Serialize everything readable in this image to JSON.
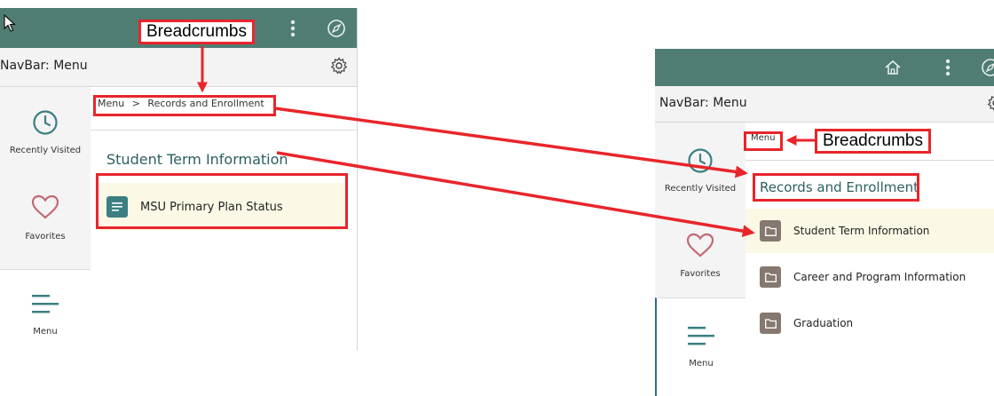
{
  "left": {
    "navbar_title": "NavBar: Menu",
    "sidebar": [
      {
        "label": "Recently Visited",
        "icon": "clock-icon"
      },
      {
        "label": "Favorites",
        "icon": "heart-icon"
      },
      {
        "label": "Menu",
        "icon": "menu-lines-icon"
      }
    ],
    "breadcrumb": {
      "root": "Menu",
      "separator": ">",
      "current": "Records and Enrollment"
    },
    "page_title": "Student Term Information",
    "tiles": [
      {
        "label": "MSU Primary Plan Status",
        "icon": "document-icon"
      }
    ],
    "annotation": "Breadcrumbs"
  },
  "right": {
    "navbar_title": "NavBar: Menu",
    "sidebar": [
      {
        "label": "Recently Visited",
        "icon": "clock-icon"
      },
      {
        "label": "Favorites",
        "icon": "heart-icon"
      },
      {
        "label": "Menu",
        "icon": "menu-lines-icon"
      }
    ],
    "breadcrumb": {
      "root": "Menu"
    },
    "page_title": "Records and Enrollment",
    "folders": [
      {
        "label": "Student Term Information",
        "icon": "folder-icon"
      },
      {
        "label": "Career and Program Information",
        "icon": "folder-icon"
      },
      {
        "label": "Graduation",
        "icon": "folder-icon"
      }
    ],
    "annotation": "Breadcrumbs"
  },
  "colors": {
    "header": "#4f7d73",
    "accent": "#3b7f82",
    "folder": "#857870",
    "annotation": "#e8252b",
    "highlight": "#fbf9e6"
  }
}
